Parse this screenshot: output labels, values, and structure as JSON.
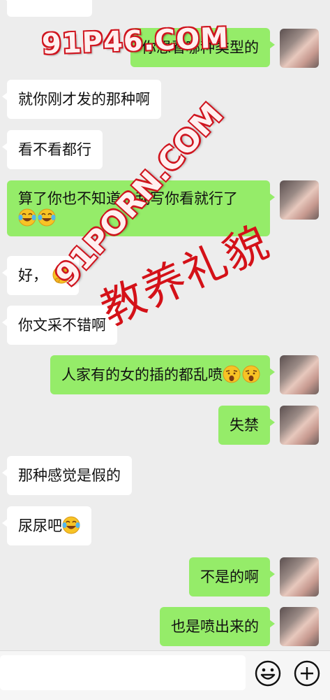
{
  "messages": [
    {
      "side": "in",
      "text": ""
    },
    {
      "side": "out",
      "text": "你想看哪种类型的"
    },
    {
      "side": "in",
      "text": "就你刚才发的那种啊"
    },
    {
      "side": "in",
      "text": "看不看都行"
    },
    {
      "side": "out",
      "text": "算了你也不知道，我写你看就行了",
      "emoji": [
        "laugh-cry-emoji",
        "laugh-cry-emoji"
      ]
    },
    {
      "side": "in",
      "text": "好，",
      "emoji": [
        "thinking-emoji"
      ]
    },
    {
      "side": "in",
      "text": "你文采不错啊"
    },
    {
      "side": "out",
      "text": "人家有的女的插的都乱喷",
      "emoji": [
        "shocked-emoji",
        "shocked-emoji"
      ]
    },
    {
      "side": "out",
      "text": "失禁"
    },
    {
      "side": "in",
      "text": "那种感觉是假的"
    },
    {
      "side": "in",
      "text": "尿尿吧",
      "emoji": [
        "laugh-cry-emoji"
      ]
    },
    {
      "side": "out",
      "text": "不是的啊"
    },
    {
      "side": "out",
      "text": "也是喷出来的"
    }
  ],
  "watermarks": {
    "site1": "91P46.COM",
    "site2": "91PORN.COM",
    "slogan": "教养礼貌"
  },
  "input_bar": {
    "input_value": "",
    "emoji_button": "smile-icon",
    "more_button": "plus-icon"
  },
  "colors": {
    "background": "#ededed",
    "incoming_bubble": "#ffffff",
    "outgoing_bubble": "#95ec69",
    "watermark_red": "#d0141e"
  }
}
